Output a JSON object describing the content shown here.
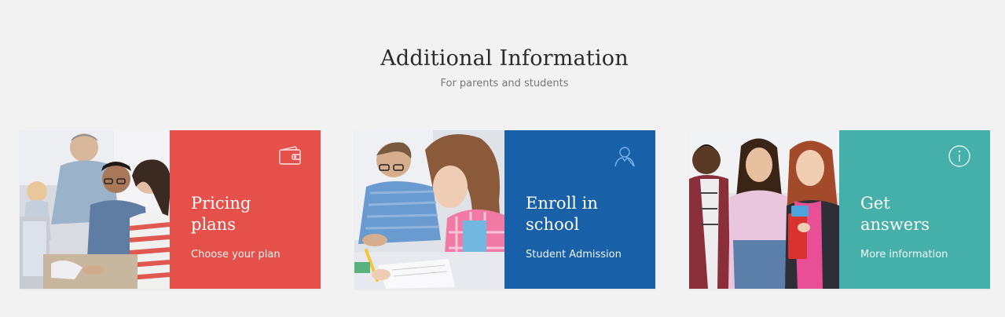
{
  "header": {
    "title": "Additional Information",
    "subtitle": "For parents and students"
  },
  "cards": [
    {
      "title_line1": "Pricing",
      "title_line2": "plans",
      "link": "Choose your plan",
      "color": "#e5504a",
      "icon": "wallet-icon"
    },
    {
      "title_line1": "Enroll in",
      "title_line2": "school",
      "link": "Student Admission",
      "color": "#1860a8",
      "icon": "user-icon"
    },
    {
      "title_line1": "Get",
      "title_line2": "answers",
      "link": "More information",
      "color": "#44b0a9",
      "icon": "info-icon"
    }
  ]
}
